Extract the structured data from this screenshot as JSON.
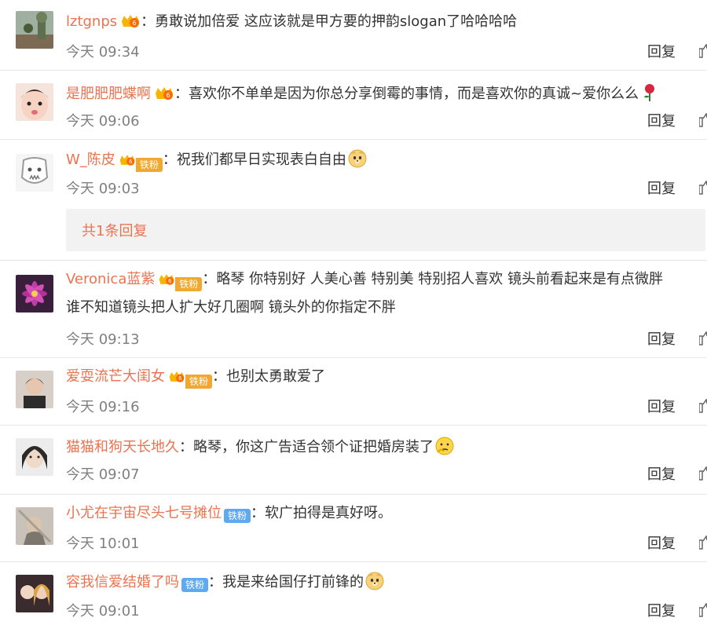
{
  "comments": [
    {
      "username": "lztgnps",
      "text": "勇敢说加倍爱 这应该就是甲方要的押韵slogan了哈哈哈哈",
      "time": "今天 09:34",
      "reply": "回复"
    },
    {
      "username": "是肥肥肥蝶啊",
      "text": "喜欢你不单单是因为你总分享倒霉的事情，而是喜欢你的真诚~爱你么么",
      "time": "今天 09:06",
      "reply": "回复"
    },
    {
      "username": "W_陈皮",
      "fan_label": "铁粉",
      "text": "祝我们都早日实现表白自由",
      "time": "今天 09:03",
      "reply": "回复"
    },
    {
      "username": "Veronica蓝紫",
      "fan_label": "铁粉",
      "text": "略琴 你特别好 人美心善 特别美 特别招人喜欢 镜头前看起来是有点微胖",
      "text2": "谁不知道镜头把人扩大好几圈啊 镜头外的你指定不胖",
      "time": "今天 09:13",
      "reply": "回复"
    },
    {
      "username": "爱耍流芒大闺女",
      "fan_label": "铁粉",
      "text": "也别太勇敢爱了",
      "time": "今天 09:16",
      "reply": "回复"
    },
    {
      "username": "猫猫和狗天长地久",
      "text": "略琴，你这广告适合领个证把婚房装了",
      "time": "今天 09:07",
      "reply": "回复"
    },
    {
      "username": "小尤在宇宙尽头七号摊位",
      "fan_label": "铁粉",
      "text": "软广拍得是真好呀。",
      "time": "今天 10:01",
      "reply": "回复"
    },
    {
      "username": "容我信爱结婚了吗",
      "fan_label": "铁粉",
      "text": "我是来给国仔打前锋的",
      "time": "今天 09:01",
      "reply": "回复"
    }
  ],
  "sub_replies_label": "共1条回复",
  "colon": "：",
  "colors": {
    "name": "#eb7350",
    "fan_badge": "#5ea9f0",
    "time": "#808080"
  }
}
